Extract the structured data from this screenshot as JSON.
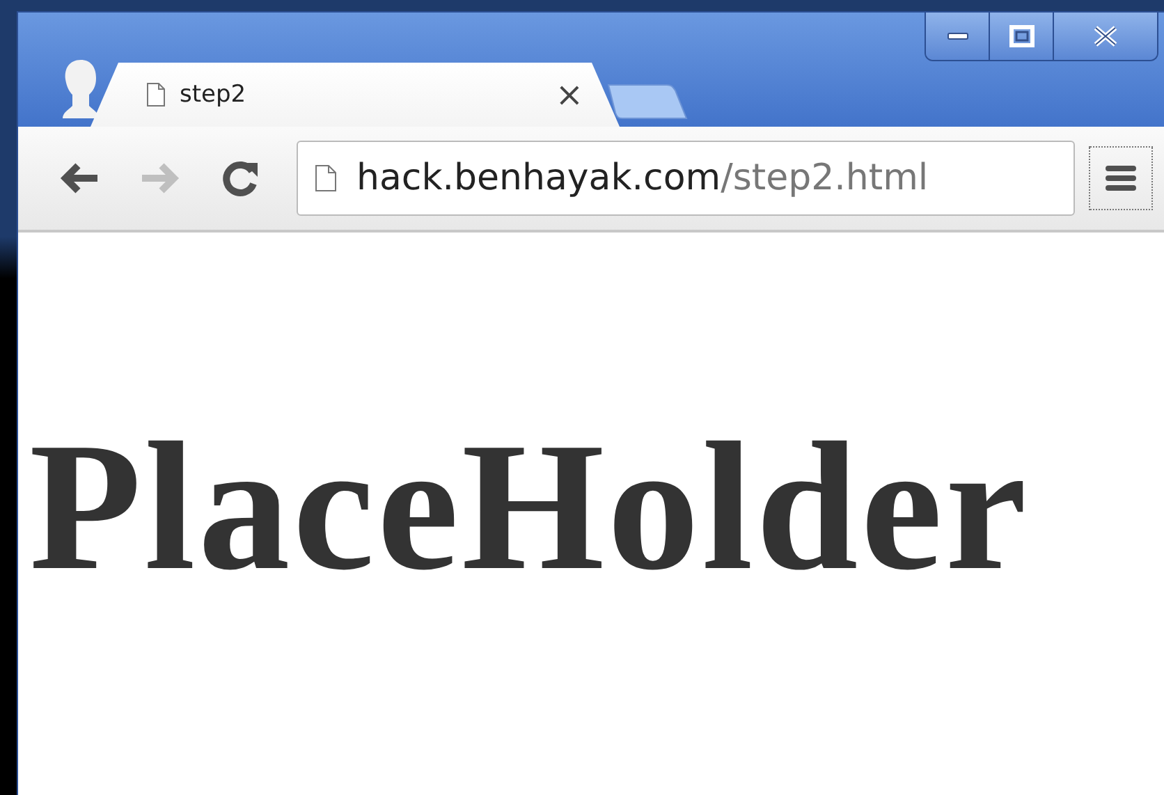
{
  "tab": {
    "title": "step2",
    "close": "×",
    "selected": true
  },
  "address": {
    "host": "hack.benhayak.com",
    "path": "/step2.html"
  },
  "page": {
    "heading": "PlaceHolder"
  }
}
